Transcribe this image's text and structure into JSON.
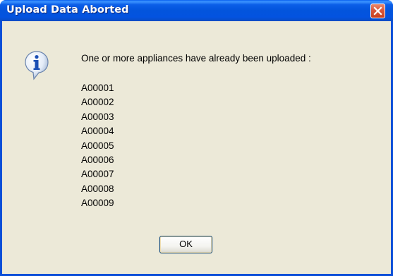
{
  "window": {
    "title": "Upload Data Aborted"
  },
  "icons": {
    "info": "info-icon",
    "close": "close-icon"
  },
  "message": {
    "text": "One or more appliances have already been uploaded :",
    "codes": [
      "A00001",
      "A00002",
      "A00003",
      "A00004",
      "A00005",
      "A00006",
      "A00007",
      "A00008",
      "A00009"
    ]
  },
  "buttons": {
    "ok_label": "OK"
  },
  "colors": {
    "titlebar": "#0354dc",
    "dialog_background": "#ece9d8",
    "close_button": "#d9563a"
  }
}
